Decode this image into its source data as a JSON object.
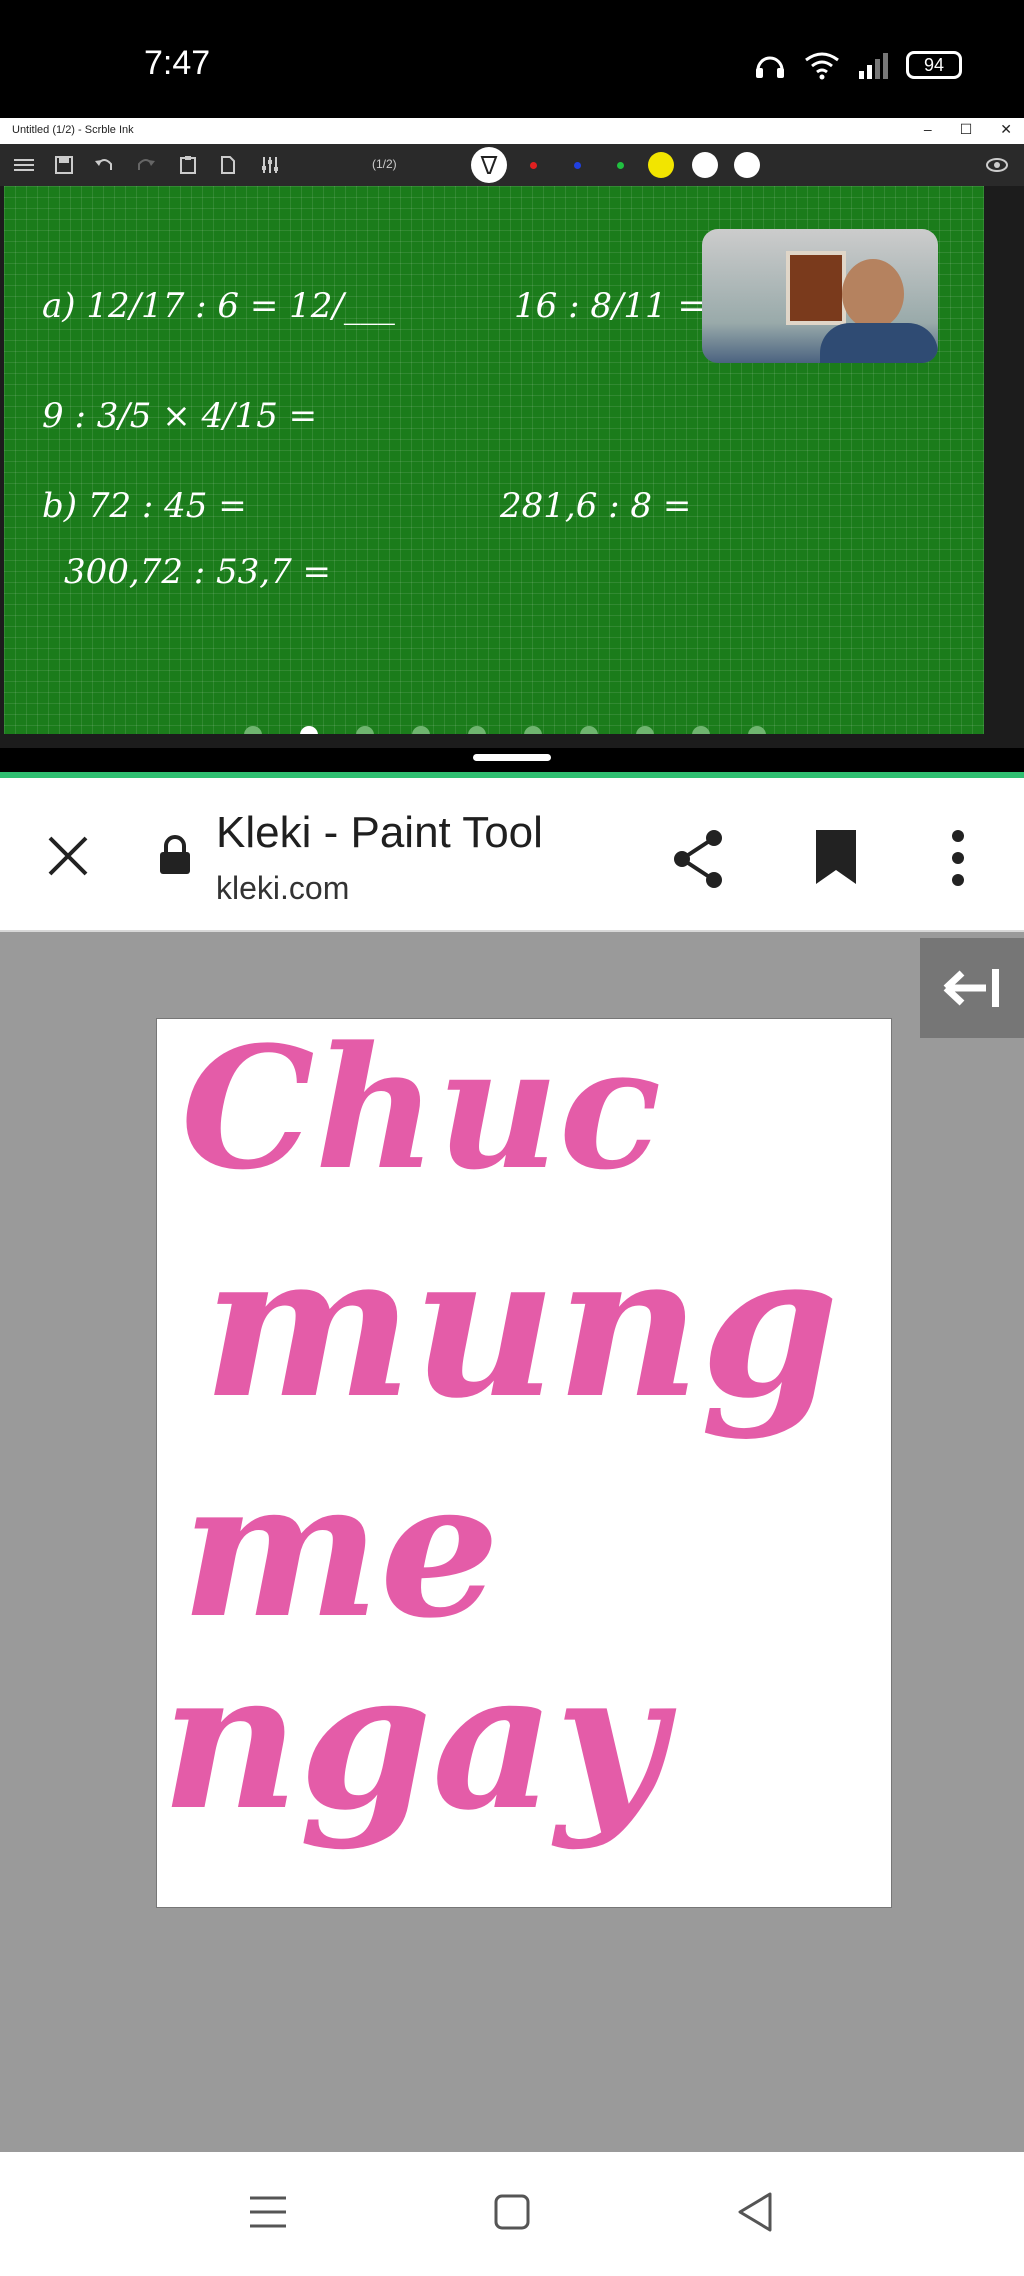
{
  "status_bar": {
    "time": "7:47",
    "battery": "94"
  },
  "app_window": {
    "title": "Untitled (1/2) - Scrble Ink",
    "page_indicator": "(1/2)",
    "board_lines": [
      {
        "text": "a) 12/17 : 6 = 12/___"
      },
      {
        "text": "16 : 8/11 ="
      },
      {
        "text": "9 : 3/5 × 4/15 ="
      },
      {
        "text": "b) 72 : 45 ="
      },
      {
        "text": "281,6 : 8 ="
      },
      {
        "text": "300,72 : 53,7 ="
      }
    ],
    "slide_dots": 10,
    "active_dot": 1
  },
  "browser": {
    "title": "Kleki - Paint Tool",
    "url": "kleki.com"
  },
  "canvas": {
    "words": [
      "Chuc",
      "mung",
      "me",
      "ngay"
    ],
    "ink_color": "#e45ca8"
  },
  "colors": {
    "board_green": "#1b7c1b",
    "accent_green": "#2fbf71",
    "page_gray": "#9a9a9a"
  }
}
